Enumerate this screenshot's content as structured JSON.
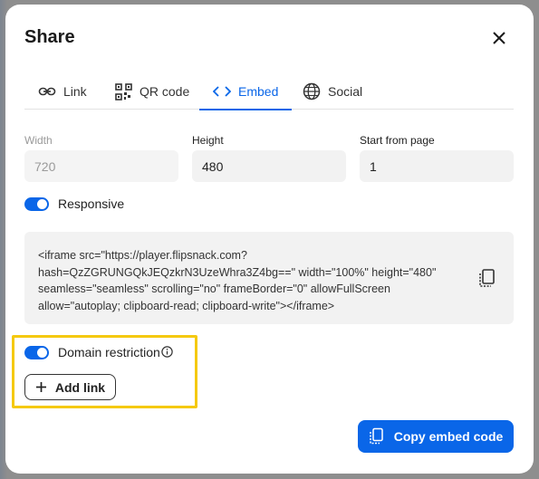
{
  "dialog": {
    "title": "Share"
  },
  "tabs": [
    {
      "label": "Link",
      "icon": "link-icon",
      "active": false
    },
    {
      "label": "QR code",
      "icon": "qr-code-icon",
      "active": false
    },
    {
      "label": "Embed",
      "icon": "code-icon",
      "active": true
    },
    {
      "label": "Social",
      "icon": "globe-icon",
      "active": false
    }
  ],
  "fields": {
    "width": {
      "label": "Width",
      "value": "720",
      "disabled": true
    },
    "height": {
      "label": "Height",
      "value": "480",
      "disabled": false
    },
    "start_page": {
      "label": "Start from page",
      "value": "1",
      "disabled": false
    }
  },
  "responsive": {
    "label": "Responsive",
    "enabled": true
  },
  "embed_code": "<iframe src=\"https://player.flipsnack.com?\nhash=QzZGRUNGQkJEQzkrN3UzeWhra3Z4bg==\" width=\"100%\" height=\"480\"\nseamless=\"seamless\" scrolling=\"no\" frameBorder=\"0\" allowFullScreen\nallow=\"autoplay; clipboard-read; clipboard-write\"></iframe>",
  "domain_restriction": {
    "label": "Domain restriction",
    "enabled": true,
    "info_icon": "info-icon"
  },
  "add_link": {
    "label": "Add link",
    "icon": "plus-icon"
  },
  "copy_button": {
    "label": "Copy embed code",
    "icon": "copy-icon"
  },
  "colors": {
    "accent": "#0a66e8",
    "highlight": "#f5c90f",
    "field_bg": "#f2f2f2"
  }
}
